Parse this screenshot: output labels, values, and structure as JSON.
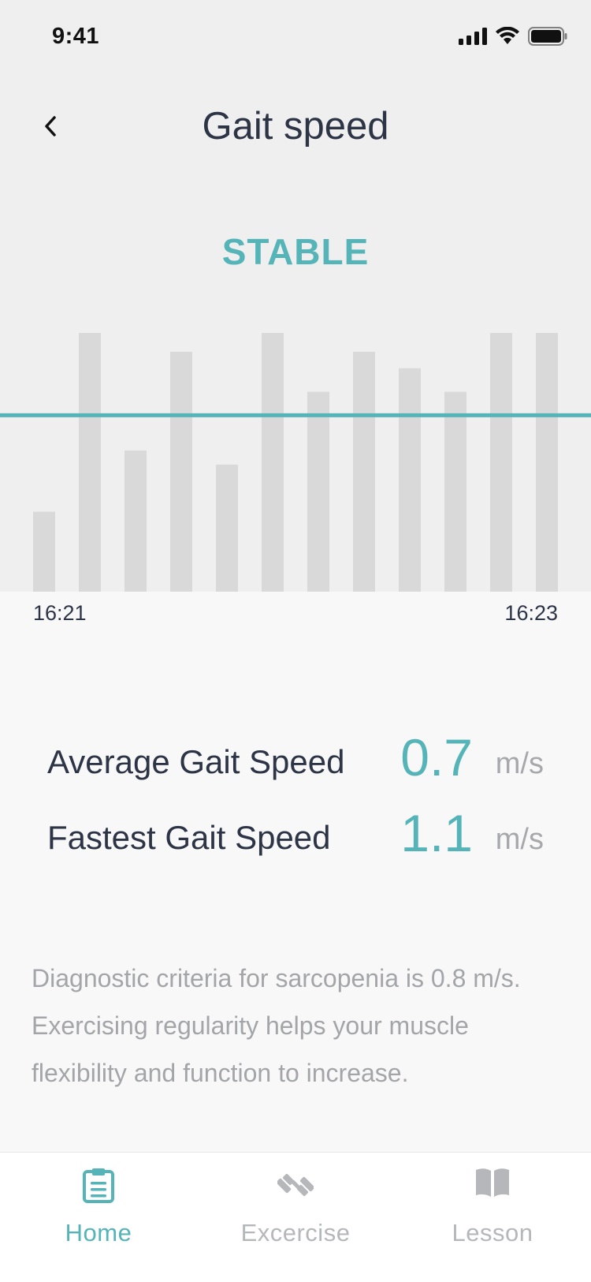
{
  "status_bar": {
    "time": "9:41"
  },
  "header": {
    "title": "Gait speed",
    "state": "STABLE"
  },
  "colors": {
    "accent": "#55b4b8",
    "bar": "#d9d9d9",
    "inactive": "#b5b7bb",
    "text": "#2c3446"
  },
  "chart_data": {
    "type": "bar",
    "values": [
      0.34,
      1.1,
      0.6,
      1.02,
      0.54,
      1.1,
      0.85,
      1.02,
      0.95,
      0.85,
      1.1,
      1.1
    ],
    "ylim": [
      0,
      1.1
    ],
    "reference_line": 0.75,
    "x_tick_labels": [
      "16:21",
      "16:23"
    ],
    "grid": false
  },
  "stats": {
    "average": {
      "label": "Average Gait Speed",
      "value": "0.7",
      "unit": "m/s"
    },
    "fastest": {
      "label": "Fastest Gait Speed",
      "value": "1.1",
      "unit": "m/s"
    }
  },
  "note": "Diagnostic criteria for sarcopenia is 0.8 m/s. Exercising regularity helps your muscle flexibility and function to increase.",
  "tabs": [
    {
      "label": "Home",
      "icon": "clipboard-icon",
      "active": true
    },
    {
      "label": "Excercise",
      "icon": "dumbbell-icon",
      "active": false
    },
    {
      "label": "Lesson",
      "icon": "book-icon",
      "active": false
    }
  ]
}
